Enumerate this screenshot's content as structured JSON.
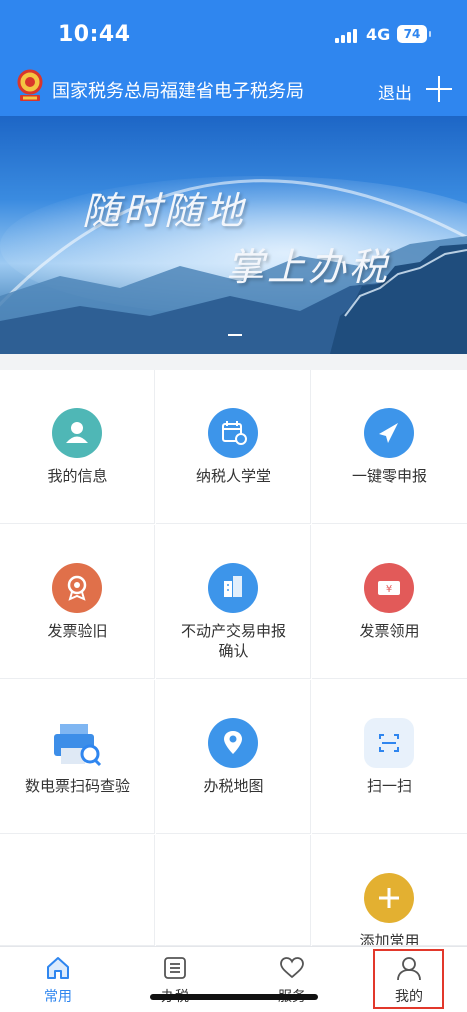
{
  "status": {
    "time": "10:44",
    "network": "4G",
    "battery": "74"
  },
  "header": {
    "title": "国家税务总局福建省电子税务局",
    "logout_label": "退出",
    "add_icon": "plus-icon",
    "emblem_icon": "tax-emblem-icon"
  },
  "banner": {
    "line1": "随时随地",
    "line2": "掌上办税"
  },
  "grid": [
    {
      "label": "我的信息",
      "icon": "user-icon",
      "color": "#4fb7b6"
    },
    {
      "label": "纳税人学堂",
      "icon": "calendar-icon",
      "color": "#3d95ea"
    },
    {
      "label": "一键零申报",
      "icon": "paper-plane-icon",
      "color": "#3d95ea"
    },
    {
      "label": "发票验旧",
      "icon": "seal-icon",
      "color": "#e0704a"
    },
    {
      "label": "不动产交易申报确认",
      "icon": "building-icon",
      "color": "#3d95ea"
    },
    {
      "label": "发票领用",
      "icon": "ticket-icon",
      "color": "#e25a59"
    },
    {
      "label": "数电票扫码查验",
      "icon": "printer-search-icon",
      "color": "#3d95ea"
    },
    {
      "label": "办税地图",
      "icon": "map-pin-icon",
      "color": "#3d95ea"
    },
    {
      "label": "扫一扫",
      "icon": "scan-icon",
      "color": "#e8f1fb"
    },
    {
      "label": "添加常用",
      "icon": "add-circle-icon",
      "color": "#e3b031"
    }
  ],
  "tabs": [
    {
      "label": "常用",
      "icon": "home-icon"
    },
    {
      "label": "办税",
      "icon": "list-icon"
    },
    {
      "label": "服务",
      "icon": "heart-icon"
    },
    {
      "label": "我的",
      "icon": "person-icon"
    }
  ],
  "colors": {
    "primary": "#2f86ef",
    "highlight": "#e2382b"
  }
}
